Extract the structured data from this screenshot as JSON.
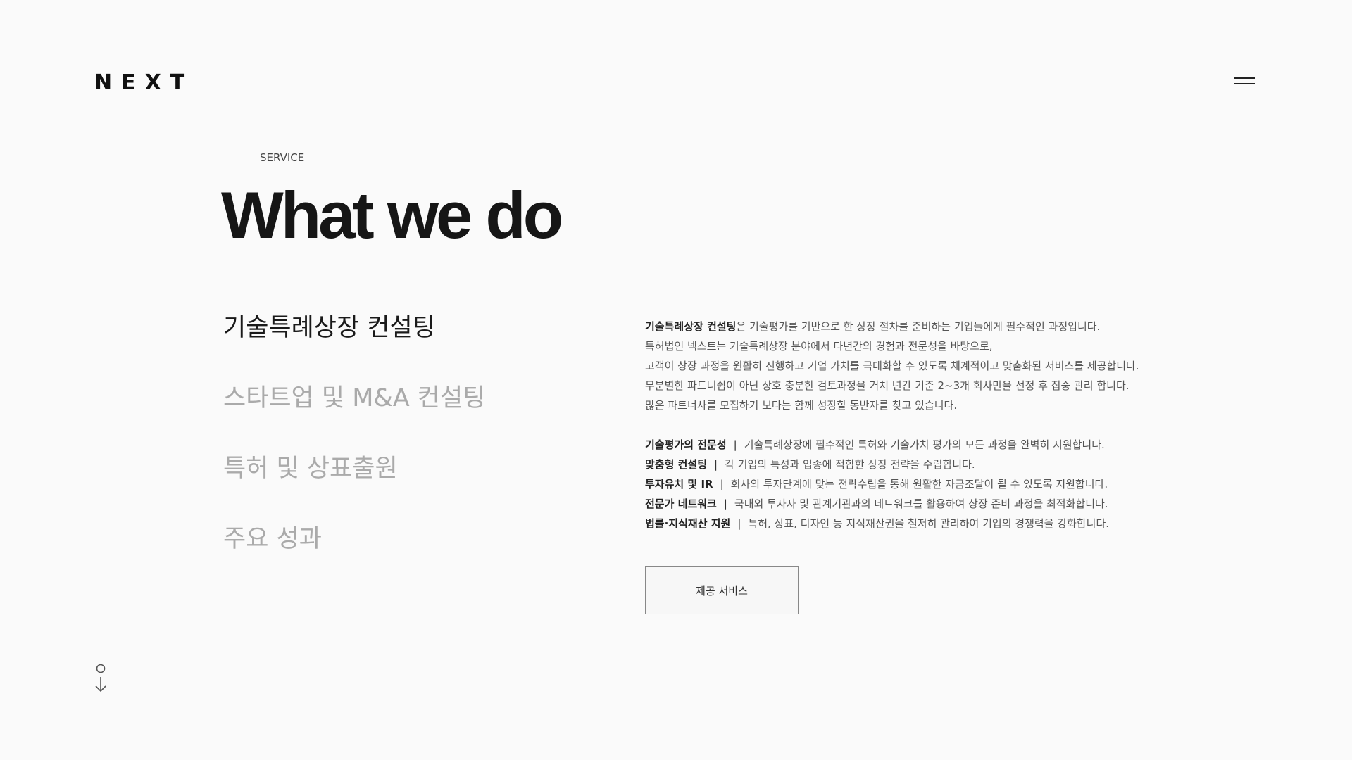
{
  "header": {
    "logo": "NEXT",
    "menu_icon": "hamburger-menu-icon"
  },
  "section": {
    "eyebrow": "SERVICE",
    "title": "What we do"
  },
  "tabs": [
    {
      "label": "기술특례상장 컨설팅",
      "active": true
    },
    {
      "label": "스타트업 및 M&A 컨설팅",
      "active": false
    },
    {
      "label": "특허 및 상표출원",
      "active": false
    },
    {
      "label": "주요 성과",
      "active": false
    }
  ],
  "description": {
    "lead_bold": "기술특례상장 컨설팅",
    "lead_rest": "은 기술평가를 기반으로 한 상장 절차를 준비하는 기업들에게 필수적인 과정입니다.",
    "lines": [
      "특허법인 넥스트는 기술특례상장 분야에서 다년간의 경험과 전문성을 바탕으로,",
      "고객이 상장 과정을 원활히 진행하고 기업 가치를 극대화할 수 있도록 체계적이고 맞춤화된 서비스를 제공합니다.",
      "무분별한 파트너쉽이 아닌 상호 충분한 검토과정을 거쳐 년간 기준 2~3개 회사만을 선정 후 집중 관리 합니다.",
      "많은 파트너사를 모집하기 보다는 함께 성장할 동반자를 찾고 있습니다."
    ]
  },
  "features": [
    {
      "key": "기술평가의 전문성",
      "sep": "|",
      "text": "기술특례상장에 필수적인 특허와 기술가치 평가의 모든 과정을 완벽히 지원합니다."
    },
    {
      "key": "맞춤형 컨설팅",
      "sep": "|",
      "text": "각 기업의 특성과 업종에 적합한 상장 전략을 수립합니다."
    },
    {
      "key": "투자유치 및 IR",
      "sep": "|",
      "text": "회사의 투자단계에 맞는 전략수립을 통해 원활한 자금조달이 될 수 있도록 지원합니다."
    },
    {
      "key": "전문가 네트워크",
      "sep": "|",
      "text": "국내외 투자자 및 관계기관과의 네트워크를 활용하여 상장 준비 과정을 최적화합니다."
    },
    {
      "key": "법률·지식재산 지원",
      "sep": "|",
      "text": "특허, 상표, 디자인 등 지식재산권을 철저히 관리하여 기업의 경쟁력을 강화합니다."
    }
  ],
  "cta": {
    "label": "제공 서비스"
  },
  "scroll": {
    "icon": "scroll-down-arrow-icon"
  }
}
